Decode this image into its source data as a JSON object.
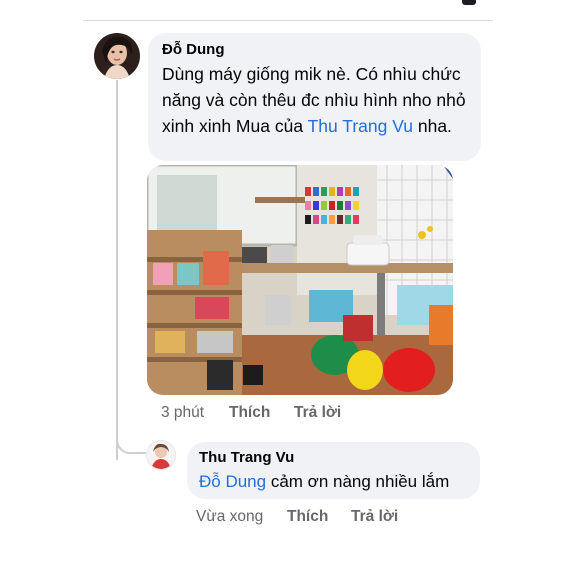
{
  "comment": {
    "author": "Đỗ Dung",
    "text_before": "Dùng máy giống mik nè. Có nhìu chức năng và còn thêu đc nhìu hình nho nhỏ xinh xinh   Mua của ",
    "mention": "Thu Trang Vu",
    "text_after": " nha.",
    "time": "3 phút",
    "like_label": "Thích",
    "reply_label": "Trả lời"
  },
  "reply": {
    "author": "Thu Trang Vu",
    "mention": "Đỗ Dung",
    "text": " cảm ơn nàng nhiều lắm",
    "time": "Vừa xong",
    "like_label": "Thích",
    "reply_label": "Trả lời"
  },
  "colors": {
    "bubble": "#f0f2f5",
    "mention": "#216fdb",
    "meta": "#65676b"
  }
}
